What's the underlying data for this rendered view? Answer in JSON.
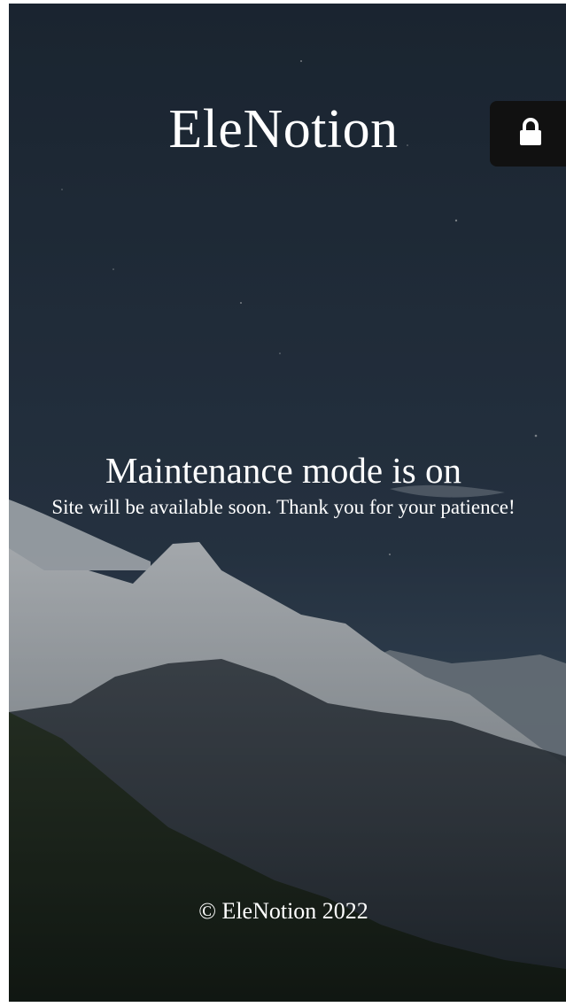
{
  "header": {
    "site_title": "EleNotion"
  },
  "lock_button": {
    "icon": "lock-icon"
  },
  "maintenance": {
    "headline": "Maintenance mode is on",
    "message": "Site will be available soon. Thank you for your patience!"
  },
  "footer": {
    "copyright": "© EleNotion 2022"
  },
  "colors": {
    "sky_top": "#1f2a38",
    "sky_bottom": "#3a4b5e",
    "snow": "#c9cdd2",
    "foreground_hill": "#1e2a1c",
    "lock_panel": "#111111",
    "text": "#ffffff"
  }
}
